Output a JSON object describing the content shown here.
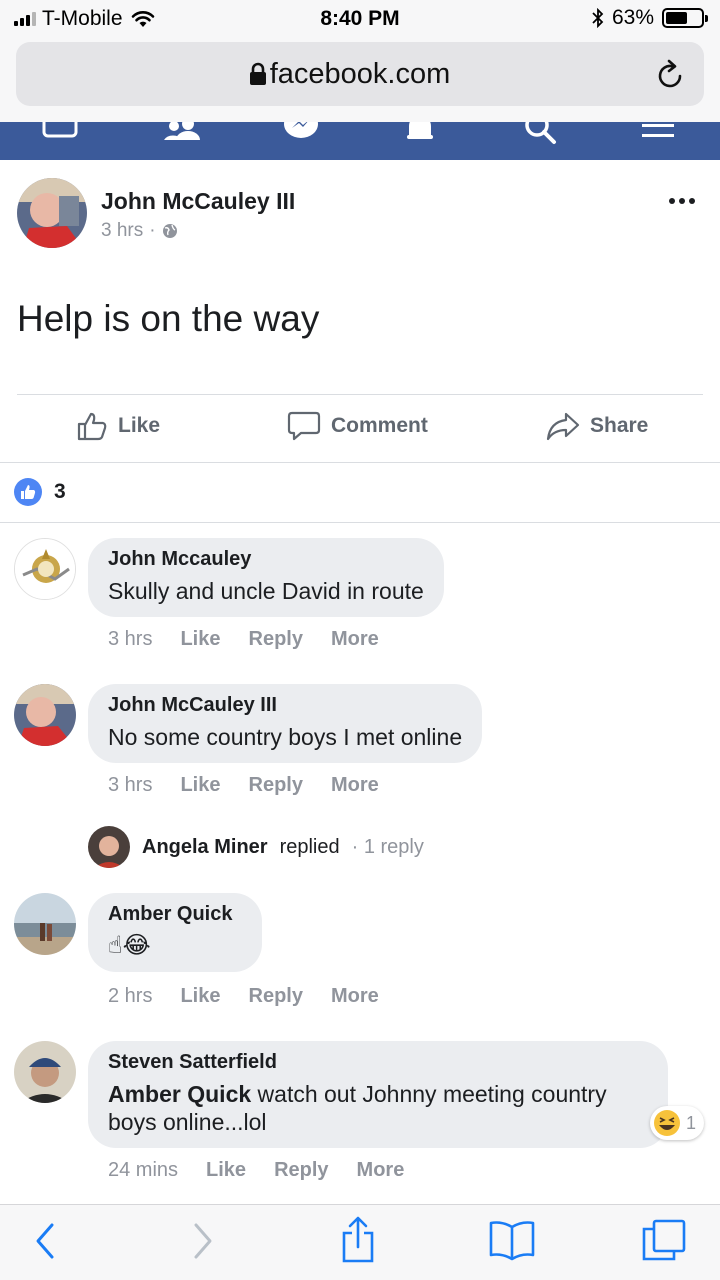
{
  "status_bar": {
    "carrier": "T-Mobile",
    "time": "8:40 PM",
    "battery": "63%",
    "battery_level": 0.63
  },
  "browser": {
    "domain": "facebook.com"
  },
  "post": {
    "author": "John McCauley III",
    "time": "3 hrs",
    "separator": "·",
    "text": "Help is on the way",
    "actions": {
      "like": "Like",
      "comment": "Comment",
      "share": "Share"
    },
    "reaction_count": "3"
  },
  "comments": [
    {
      "author": "John Mccauley",
      "text": "Skully and uncle David in route",
      "time": "3 hrs",
      "like": "Like",
      "reply": "Reply",
      "more": "More"
    },
    {
      "author": "John McCauley III",
      "text": "No some country boys I met online",
      "time": "3 hrs",
      "like": "Like",
      "reply": "Reply",
      "more": "More"
    },
    {
      "author": "Amber Quick",
      "text": "☝😂",
      "time": "2 hrs",
      "like": "Like",
      "reply": "Reply",
      "more": "More"
    },
    {
      "author": "Steven Satterfield",
      "mention": "Amber Quick",
      "text": " watch out Johnny meeting country boys online...lol",
      "time": "24 mins",
      "like": "Like",
      "reply": "Reply",
      "more": "More",
      "reaction_count": "1"
    }
  ],
  "reply_summary": {
    "name": "Angela Miner",
    "verb": "replied",
    "count": "· 1 reply"
  },
  "colors": {
    "fb_blue": "#3b5a9a",
    "like_blue": "#4e86f4",
    "bubble": "#ebedf0",
    "meta_gray": "#90949c",
    "ios_blue": "#1a7cf5"
  }
}
